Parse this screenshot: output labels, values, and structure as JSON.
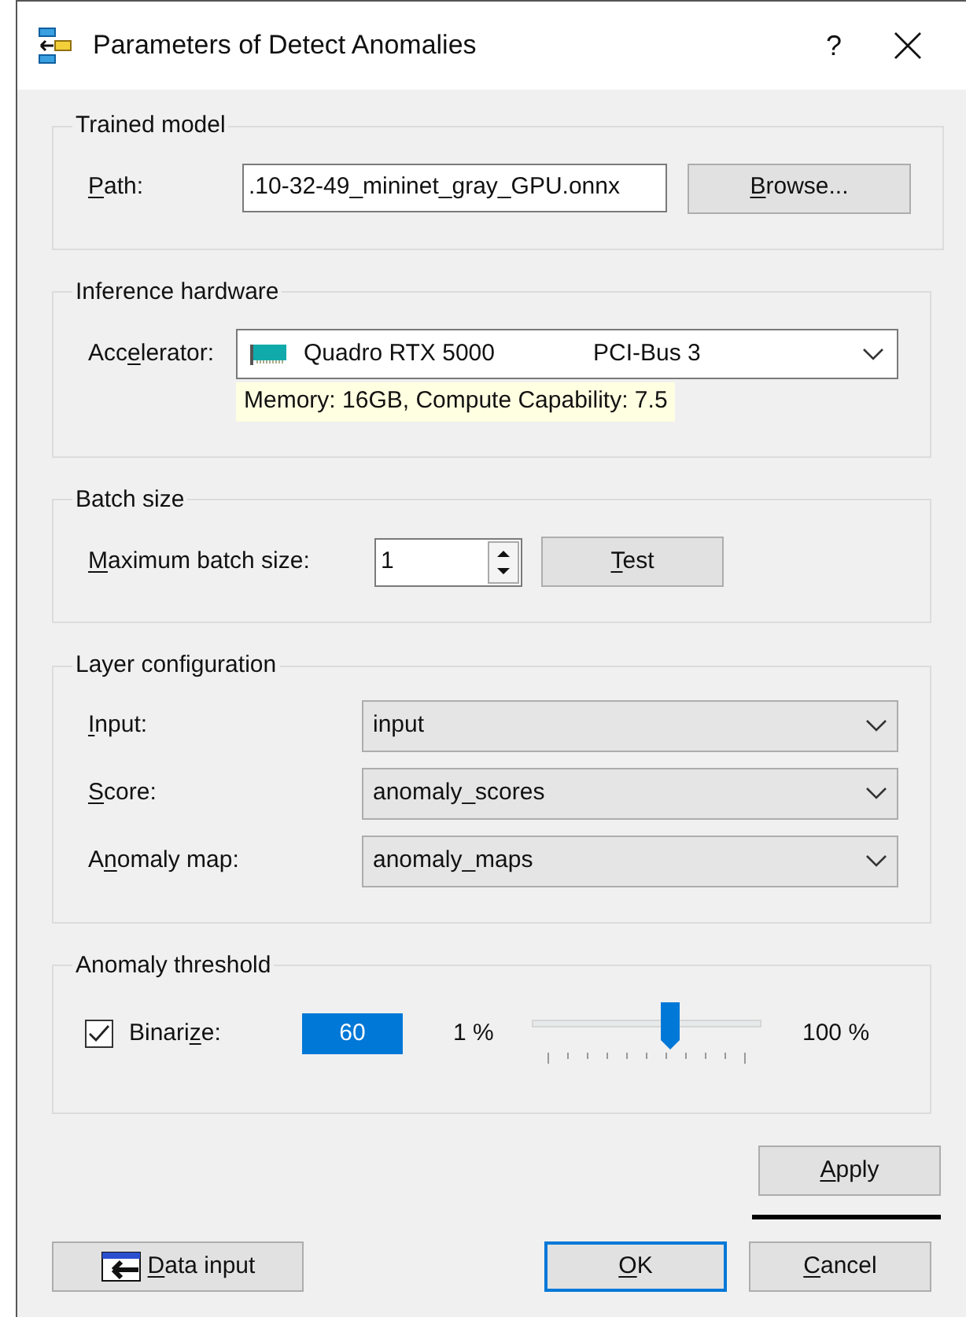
{
  "window": {
    "title": "Parameters of Detect Anomalies",
    "help": "?"
  },
  "trained_model": {
    "title": "Trained model",
    "path_label": {
      "key": "P",
      "post": "ath:"
    },
    "path_value": ".10-32-49_mininet_gray_GPU.onnx",
    "browse": {
      "key": "B",
      "post": "rowse..."
    }
  },
  "inference_hardware": {
    "title": "Inference hardware",
    "accelerator_label": {
      "pre": "Acc",
      "key": "e",
      "post": "lerator:"
    },
    "device": "Quadro RTX 5000",
    "bus": "PCI-Bus 3",
    "info": "Memory: 16GB, Compute Capability: 7.5"
  },
  "batch_size": {
    "title": "Batch size",
    "label": {
      "key": "M",
      "post": "aximum batch size:"
    },
    "value": "1",
    "test": {
      "key": "T",
      "post": "est"
    }
  },
  "layer_configuration": {
    "title": "Layer configuration",
    "rows": [
      {
        "label": {
          "key": "I",
          "post": "nput:"
        },
        "value": "input"
      },
      {
        "label": {
          "key": "S",
          "post": "core:"
        },
        "value": "anomaly_scores"
      },
      {
        "label": {
          "pre": "A",
          "key": "n",
          "post": "omaly map:"
        },
        "value": "anomaly_maps"
      }
    ]
  },
  "anomaly_threshold": {
    "title": "Anomaly threshold",
    "binarize": {
      "label": {
        "pre": "Binari",
        "key": "z",
        "post": "e:"
      },
      "checked": true
    },
    "value": "60",
    "min_label": "1 %",
    "max_label": "100 %",
    "level": 0.6
  },
  "buttons": {
    "apply": {
      "label": {
        "key": "A",
        "post": "pply"
      }
    },
    "data_input": {
      "label": {
        "key": "D",
        "post": "ata input"
      }
    },
    "ok": {
      "label": {
        "key": "O",
        "post": "K"
      },
      "selected": true
    },
    "cancel": {
      "label": {
        "key": "C",
        "post": "ancel"
      }
    }
  }
}
